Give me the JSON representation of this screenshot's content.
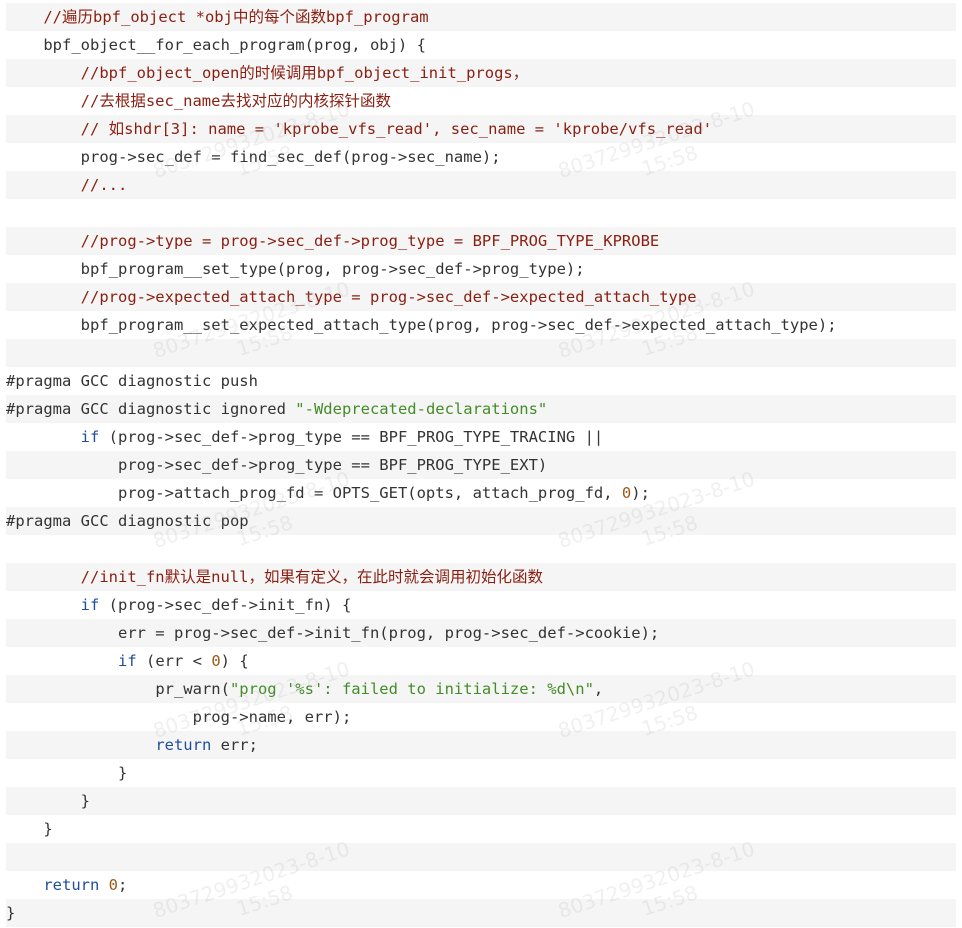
{
  "code": {
    "lines": [
      {
        "indent": "    ",
        "tokens": [
          [
            "comment",
            "//遍历bpf_object *obj中的每个函数bpf_program"
          ]
        ]
      },
      {
        "indent": "    ",
        "tokens": [
          [
            "plain",
            "bpf_object__for_each_program(prog, obj) {"
          ]
        ]
      },
      {
        "indent": "        ",
        "tokens": [
          [
            "comment",
            "//bpf_object_open的时候调用bpf_object_init_progs，"
          ]
        ]
      },
      {
        "indent": "        ",
        "tokens": [
          [
            "comment",
            "//去根据sec_name去找对应的内核探针函数"
          ]
        ]
      },
      {
        "indent": "        ",
        "tokens": [
          [
            "comment",
            "// 如shdr[3]: name = 'kprobe_vfs_read', sec_name = 'kprobe/vfs_read'"
          ]
        ]
      },
      {
        "indent": "        ",
        "tokens": [
          [
            "plain",
            "prog->sec_def = find_sec_def(prog->sec_name);"
          ]
        ]
      },
      {
        "indent": "        ",
        "tokens": [
          [
            "comment",
            "//..."
          ]
        ]
      },
      {
        "indent": "",
        "tokens": []
      },
      {
        "indent": "        ",
        "tokens": [
          [
            "comment",
            "//prog->type = prog->sec_def->prog_type = BPF_PROG_TYPE_KPROBE"
          ]
        ]
      },
      {
        "indent": "        ",
        "tokens": [
          [
            "plain",
            "bpf_program__set_type(prog, prog->sec_def->prog_type);"
          ]
        ]
      },
      {
        "indent": "        ",
        "tokens": [
          [
            "comment",
            "//prog->expected_attach_type = prog->sec_def->expected_attach_type"
          ]
        ]
      },
      {
        "indent": "        ",
        "tokens": [
          [
            "plain",
            "bpf_program__set_expected_attach_type(prog, prog->sec_def->expected_attach_type);"
          ]
        ]
      },
      {
        "indent": "",
        "tokens": []
      },
      {
        "indent": "",
        "tokens": [
          [
            "pre",
            "#pragma GCC diagnostic push"
          ]
        ]
      },
      {
        "indent": "",
        "tokens": [
          [
            "pre",
            "#pragma GCC diagnostic ignored "
          ],
          [
            "string",
            "\"-Wdeprecated-declarations\""
          ]
        ]
      },
      {
        "indent": "        ",
        "tokens": [
          [
            "keyword",
            "if"
          ],
          [
            "plain",
            " (prog->sec_def->prog_type == BPF_PROG_TYPE_TRACING ||"
          ]
        ]
      },
      {
        "indent": "            ",
        "tokens": [
          [
            "plain",
            "prog->sec_def->prog_type == BPF_PROG_TYPE_EXT)"
          ]
        ]
      },
      {
        "indent": "            ",
        "tokens": [
          [
            "plain",
            "prog->attach_prog_fd = OPTS_GET(opts, attach_prog_fd, "
          ],
          [
            "number",
            "0"
          ],
          [
            "plain",
            ");"
          ]
        ]
      },
      {
        "indent": "",
        "tokens": [
          [
            "pre",
            "#pragma GCC diagnostic pop"
          ]
        ]
      },
      {
        "indent": "",
        "tokens": []
      },
      {
        "indent": "        ",
        "tokens": [
          [
            "comment",
            "//init_fn默认是null，如果有定义，在此时就会调用初始化函数"
          ]
        ]
      },
      {
        "indent": "        ",
        "tokens": [
          [
            "keyword",
            "if"
          ],
          [
            "plain",
            " (prog->sec_def->init_fn) {"
          ]
        ]
      },
      {
        "indent": "            ",
        "tokens": [
          [
            "plain",
            "err = prog->sec_def->init_fn(prog, prog->sec_def->cookie);"
          ]
        ]
      },
      {
        "indent": "            ",
        "tokens": [
          [
            "keyword",
            "if"
          ],
          [
            "plain",
            " (err < "
          ],
          [
            "number",
            "0"
          ],
          [
            "plain",
            ") {"
          ]
        ]
      },
      {
        "indent": "                ",
        "tokens": [
          [
            "plain",
            "pr_warn("
          ],
          [
            "string",
            "\"prog '%s': failed to initialize: %d\\n\""
          ],
          [
            "plain",
            ","
          ]
        ]
      },
      {
        "indent": "                    ",
        "tokens": [
          [
            "plain",
            "prog->name, err);"
          ]
        ]
      },
      {
        "indent": "                ",
        "tokens": [
          [
            "keyword",
            "return"
          ],
          [
            "plain",
            " err;"
          ]
        ]
      },
      {
        "indent": "            ",
        "tokens": [
          [
            "plain",
            "}"
          ]
        ]
      },
      {
        "indent": "        ",
        "tokens": [
          [
            "plain",
            "}"
          ]
        ]
      },
      {
        "indent": "    ",
        "tokens": [
          [
            "plain",
            "}"
          ]
        ]
      },
      {
        "indent": "",
        "tokens": []
      },
      {
        "indent": "    ",
        "tokens": [
          [
            "keyword",
            "return"
          ],
          [
            "plain",
            " "
          ],
          [
            "number",
            "0"
          ],
          [
            "plain",
            ";"
          ]
        ]
      },
      {
        "indent": "",
        "tokens": [
          [
            "plain",
            "}"
          ]
        ]
      }
    ]
  },
  "watermark": {
    "id_text": "803729932023-8-10",
    "time_text": "15:58"
  },
  "colors": {
    "comment": "#8a1f11",
    "keyword": "#1f4e9c",
    "string": "#448c27",
    "number": "#9d5a16",
    "plain": "#333333",
    "shaded_row": "#f5f5f5"
  }
}
